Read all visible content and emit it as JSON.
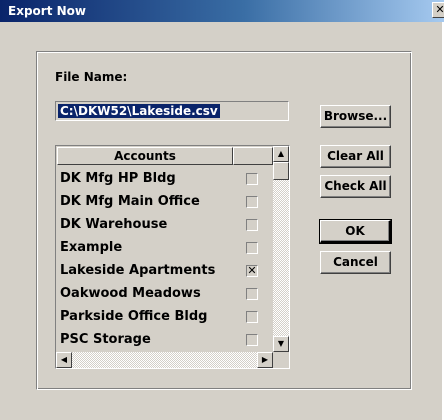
{
  "window": {
    "title": "Export Now",
    "close_glyph": "✕"
  },
  "file": {
    "label": "File Name:",
    "value": "C:\\DKW52\\Lakeside.csv"
  },
  "buttons": {
    "browse": "Browse...",
    "clear_all": "Clear All",
    "check_all": "Check All",
    "ok": "OK",
    "cancel": "Cancel"
  },
  "list": {
    "header": "Accounts",
    "rows": [
      {
        "name": "DK Mfg HP Bldg",
        "checked": false
      },
      {
        "name": "DK Mfg Main Office",
        "checked": false
      },
      {
        "name": "DK Warehouse",
        "checked": false
      },
      {
        "name": "Example",
        "checked": false
      },
      {
        "name": "Lakeside Apartments",
        "checked": true
      },
      {
        "name": "Oakwood Meadows",
        "checked": false
      },
      {
        "name": "Parkside Office Bldg",
        "checked": false
      },
      {
        "name": "PSC Storage",
        "checked": false
      }
    ]
  },
  "icons": {
    "up": "▲",
    "down": "▼",
    "left": "◀",
    "right": "▶",
    "check": "✕"
  }
}
